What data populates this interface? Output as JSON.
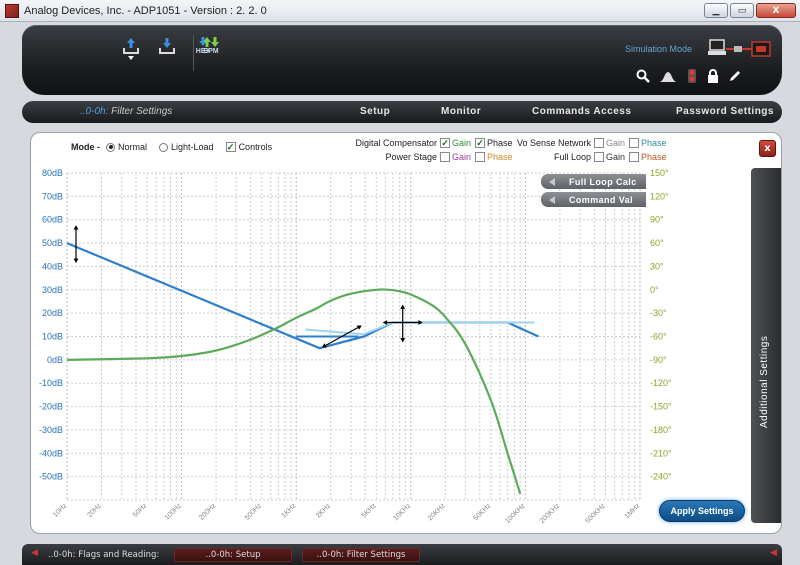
{
  "window": {
    "title": "Analog Devices, Inc. - ADP1051 - Version :  2. 2. 0",
    "buttons": {
      "minimize": "▁",
      "maximize": "▭",
      "close": "X"
    }
  },
  "toolbar": {
    "buttons": [
      {
        "name": "upload",
        "label": ""
      },
      {
        "name": "download",
        "label": ""
      },
      {
        "name": "hex",
        "label": "HEX"
      },
      {
        "name": "epm",
        "label": "EPM"
      }
    ],
    "simulation_mode": "Simulation Mode",
    "tools": [
      "search-icon",
      "waveform-icon",
      "traffic-light-icon",
      "lock-icon",
      "pen-icon"
    ]
  },
  "nav": {
    "breadcrumb_addr": "..0-0h:",
    "breadcrumb_page": "Filter Settings",
    "menu": [
      "Setup",
      "Monitor",
      "Commands Access",
      "Password Settings"
    ]
  },
  "options": {
    "mode_label": "Mode -",
    "normal": "Normal",
    "light_load": "Light-Load",
    "controls": "Controls",
    "mode_selected": "Normal",
    "controls_checked": true
  },
  "legend": {
    "rows": [
      {
        "name": "Digital Compensator",
        "gain": "Gain",
        "gain_checked": true,
        "phase": "Phase",
        "phase_checked": true,
        "gain_color": "#2f8f3a",
        "phase_color": "#222222"
      },
      {
        "name": "Power Stage",
        "gain": "Gain",
        "gain_checked": false,
        "phase": "Phase",
        "phase_checked": false,
        "gain_color": "#9a3d9a",
        "phase_color": "#d08a2a"
      },
      {
        "name": "Vo Sense Network",
        "gain": "Gain",
        "gain_checked": false,
        "phase": "Phase",
        "phase_checked": false,
        "gain_color": "#888888",
        "phase_color": "#2a8fa0"
      },
      {
        "name": "Full Loop",
        "gain": "Gain",
        "gain_checked": false,
        "phase": "Phase",
        "phase_checked": false,
        "gain_color": "#333333",
        "phase_color": "#c0552a"
      }
    ]
  },
  "chart_buttons": {
    "full_loop_calc": "Full Loop Calc",
    "command_val": "Command Val"
  },
  "side_tab": "Additional Settings",
  "apply_button": "Apply Settings",
  "chart_data": {
    "type": "line",
    "x_scale": "log",
    "x_range_hz": [
      10,
      1000000
    ],
    "x_ticks": [
      {
        "v": 10,
        "label": "10Hz"
      },
      {
        "v": 20,
        "label": "20Hz"
      },
      {
        "v": 50,
        "label": "50Hz"
      },
      {
        "v": 100,
        "label": "100Hz"
      },
      {
        "v": 200,
        "label": "200Hz"
      },
      {
        "v": 500,
        "label": "500Hz"
      },
      {
        "v": 1000,
        "label": "1KHz"
      },
      {
        "v": 2000,
        "label": "2KHz"
      },
      {
        "v": 5000,
        "label": "5KHz"
      },
      {
        "v": 10000,
        "label": "10KHz"
      },
      {
        "v": 20000,
        "label": "20KHz"
      },
      {
        "v": 50000,
        "label": "50KHz"
      },
      {
        "v": 100000,
        "label": "100KHz"
      },
      {
        "v": 200000,
        "label": "200KHz"
      },
      {
        "v": 500000,
        "label": "500KHz"
      },
      {
        "v": 1000000,
        "label": "1MHz"
      }
    ],
    "y_left": {
      "range": [
        -60,
        80
      ],
      "ticks": [
        80,
        70,
        60,
        50,
        40,
        30,
        20,
        10,
        0,
        -10,
        -20,
        -30,
        -40,
        -50
      ],
      "labels": [
        "80dB",
        "70dB",
        "60dB",
        "50dB",
        "40dB",
        "30dB",
        "20dB",
        "10dB",
        "0dB",
        "-10dB",
        "-20dB",
        "-30dB",
        "-40dB",
        "-50dB"
      ],
      "color": "#2a74b8"
    },
    "y_right": {
      "range": [
        -270,
        150
      ],
      "ticks": [
        150,
        120,
        90,
        60,
        30,
        0,
        -30,
        -60,
        -90,
        -120,
        -150,
        -180,
        -210,
        -240
      ],
      "labels": [
        "150°",
        "120°",
        "90°",
        "60°",
        "30°",
        "0°",
        "-30°",
        "-60°",
        "-90°",
        "-120°",
        "-150°",
        "-180°",
        "-210°",
        "-240°"
      ],
      "color": "#8aa52a"
    },
    "grid": true,
    "series": [
      {
        "kind": "gain",
        "color": "#2f7fcf",
        "points": [
          [
            10,
            50
          ],
          [
            1600,
            5
          ],
          [
            3900,
            10
          ],
          [
            7000,
            16
          ],
          [
            70000,
            16
          ],
          [
            130000,
            10
          ]
        ]
      },
      {
        "kind": "gain-asymptote",
        "color": "#9fd3ee",
        "points": [
          [
            1200,
            13
          ],
          [
            3900,
            11
          ],
          [
            7000,
            16
          ],
          [
            120000,
            16
          ]
        ]
      },
      {
        "kind": "gain-asymptote-dark",
        "color": "#2f7fcf",
        "points": [
          [
            1000,
            10
          ],
          [
            3500,
            10
          ]
        ]
      },
      {
        "kind": "phase",
        "axis": "right",
        "color": "#5daa5a",
        "points": [
          [
            10,
            -90
          ],
          [
            50,
            -88
          ],
          [
            100,
            -85
          ],
          [
            200,
            -78
          ],
          [
            400,
            -64
          ],
          [
            700,
            -48
          ],
          [
            1000,
            -36
          ],
          [
            1500,
            -24
          ],
          [
            2000,
            -14
          ],
          [
            3000,
            -5
          ],
          [
            5000,
            0
          ],
          [
            6500,
            0
          ],
          [
            8000,
            -2
          ],
          [
            10000,
            -6
          ],
          [
            15000,
            -19
          ],
          [
            20000,
            -35
          ],
          [
            30000,
            -70
          ],
          [
            50000,
            -142
          ],
          [
            70000,
            -210
          ],
          [
            90000,
            -262
          ]
        ]
      }
    ],
    "markers": [
      {
        "f": 10,
        "db": 50,
        "type": "vertical"
      },
      {
        "f": 2500,
        "db": 10,
        "type": "diagonal"
      },
      {
        "f": 8500,
        "db": 16,
        "type": "cross"
      }
    ]
  },
  "bottom": {
    "tabs": [
      {
        "label": "..0-0h: Flags and Reading:",
        "active": false
      },
      {
        "label": "..0-0h: Setup",
        "active": true
      },
      {
        "label": "..0-0h: Filter Settings",
        "active": true
      }
    ],
    "left_arrow": "◀",
    "right_arrow": "◀"
  }
}
